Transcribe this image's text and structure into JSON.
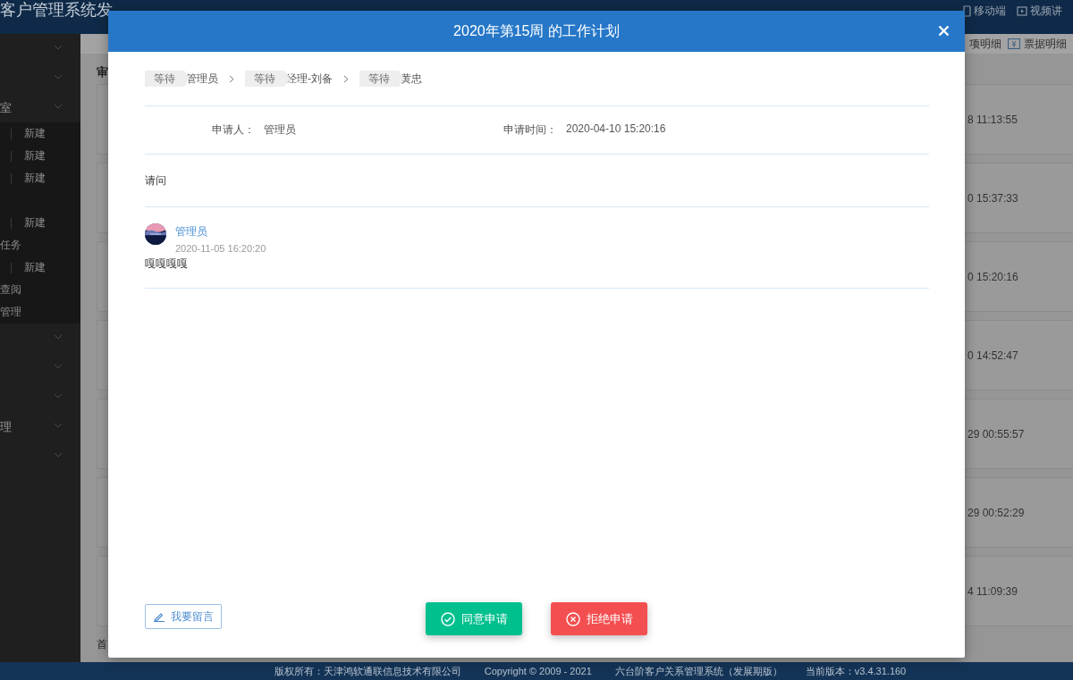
{
  "app": {
    "title": "客户管理系统发",
    "header_links": [
      {
        "label": "移动端"
      },
      {
        "label": "视频讲"
      }
    ],
    "toolbar_links": [
      {
        "label": "项明细"
      },
      {
        "label": "票据明细"
      }
    ]
  },
  "sidebar": {
    "items": [
      {
        "kind": "menu",
        "expanded": false
      },
      {
        "kind": "menu",
        "expanded": false
      },
      {
        "kind": "menu",
        "label": "室",
        "expanded": false
      },
      {
        "kind": "sub",
        "action": "新建"
      },
      {
        "kind": "sub",
        "action": "新建"
      },
      {
        "kind": "sub",
        "action": "新建"
      },
      {
        "kind": "sub"
      },
      {
        "kind": "sub",
        "action": "新建"
      },
      {
        "kind": "sub",
        "label": "任务"
      },
      {
        "kind": "sub",
        "action": "新建"
      },
      {
        "kind": "sub",
        "label": "查阅"
      },
      {
        "kind": "sub",
        "label": "管理"
      },
      {
        "kind": "menu",
        "expanded": false
      },
      {
        "kind": "menu",
        "expanded": false
      },
      {
        "kind": "menu",
        "expanded": false
      },
      {
        "kind": "menu",
        "label": "理",
        "expanded": false
      },
      {
        "kind": "menu",
        "expanded": false
      }
    ]
  },
  "main": {
    "heading": "审",
    "cards": [
      {
        "time": "8 11:13:55"
      },
      {
        "time": "0 15:37:33"
      },
      {
        "time": "0 15:20:16"
      },
      {
        "time": "0 14:52:47"
      },
      {
        "time": "29 00:55:57"
      },
      {
        "time": "29 00:52:29"
      },
      {
        "time": "4 11:09:39"
      }
    ],
    "pager": "首"
  },
  "modal": {
    "title": "2020年第15周 的工作计划",
    "steps": [
      {
        "status": "等待",
        "name": "管理员"
      },
      {
        "status": "等待",
        "name": "经理-刘备"
      },
      {
        "status": "等待",
        "name": "黄忠"
      }
    ],
    "applicant_label": "申请人：",
    "applicant": "管理员",
    "time_label": "申请时间：",
    "time": "2020-04-10 15:20:16",
    "content": "请问",
    "comments": [
      {
        "author": "管理员",
        "time": "2020-11-05 16:20:20",
        "text": "嘎嘎嘎嘎"
      }
    ],
    "buttons": [
      {
        "kind": "comment",
        "label": "我要留言"
      },
      {
        "kind": "approve",
        "label": "同意申请"
      },
      {
        "kind": "reject",
        "label": "拒绝申请"
      }
    ]
  },
  "footer": [
    "版权所有：天津鸿软通联信息技术有限公司",
    "Copyright © 2009 - 2021",
    "六台阶客户关系管理系统（发展期版）",
    "当前版本：v3.4.31.160"
  ]
}
